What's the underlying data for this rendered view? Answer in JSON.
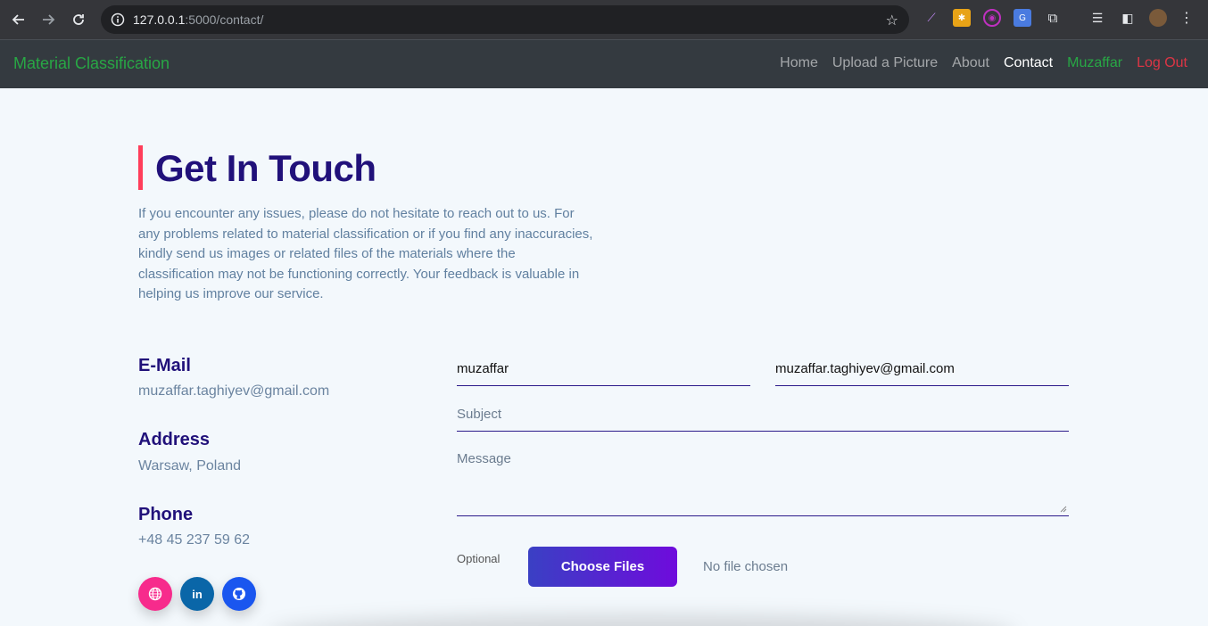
{
  "browser": {
    "url_host": "127.0.0.1",
    "url_path": ":5000/contact/"
  },
  "navbar": {
    "brand": "Material Classification",
    "items": [
      {
        "label": "Home"
      },
      {
        "label": "Upload a Picture"
      },
      {
        "label": "About"
      },
      {
        "label": "Contact"
      },
      {
        "label": "Muzaffar"
      },
      {
        "label": "Log Out"
      }
    ]
  },
  "page": {
    "title": "Get In Touch",
    "intro": "If you encounter any issues, please do not hesitate to reach out to us. For any problems related to material classification or if you find any inaccuracies, kindly send us images or related files of the materials where the classification may not be functioning correctly. Your feedback is valuable in helping us improve our service.",
    "contact": {
      "email_label": "E-Mail",
      "email": "muzaffar.taghiyev@gmail.com",
      "address_label": "Address",
      "address": "Warsaw, Poland",
      "phone_label": "Phone",
      "phone": "+48 45 237 59 62"
    },
    "form": {
      "name_value": "muzaffar",
      "email_value": "muzaffar.taghiyev@gmail.com",
      "subject_placeholder": "Subject",
      "message_placeholder": "Message",
      "optional_label": "Optional",
      "choose_files": "Choose Files",
      "no_file": "No file chosen"
    },
    "social": [
      {
        "icon": "globe-icon"
      },
      {
        "icon": "linkedin-icon",
        "text": "in"
      },
      {
        "icon": "github-icon"
      }
    ]
  },
  "colors": {
    "brand_green": "#28a745",
    "logout_red": "#dc3545",
    "title_purple": "#21117a",
    "accent_red": "#ff3d5a",
    "button_gradient_start": "#3a40c4",
    "button_gradient_end": "#6f0bdc"
  }
}
